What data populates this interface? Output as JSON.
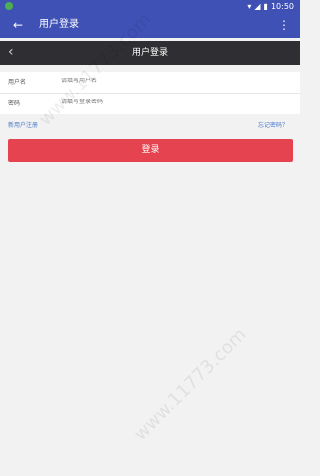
{
  "status_bar": {
    "time": "10:50"
  },
  "app_bar": {
    "title": "用户登录",
    "menu_icon": "⋮"
  },
  "sub_header": {
    "title": "用户登录"
  },
  "form": {
    "username_label": "用户名",
    "username_placeholder": "请填写用户名",
    "password_label": "密码",
    "password_placeholder": "请填写登录密码"
  },
  "links": {
    "register": "新用户注册",
    "forgot": "忘记密码？"
  },
  "button": {
    "login": "登录"
  },
  "watermark": "www.11773.com"
}
